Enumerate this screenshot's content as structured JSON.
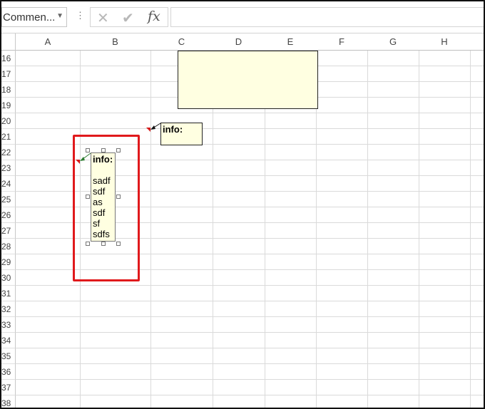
{
  "formula_bar": {
    "name_box_value": "Commen...",
    "dots": "⋮",
    "cancel_icon": "✕",
    "enter_icon": "✔",
    "fx_label": "fx",
    "formula_value": ""
  },
  "columns": [
    "A",
    "B",
    "C",
    "D",
    "E",
    "F",
    "G",
    "H"
  ],
  "rows": [
    "16",
    "17",
    "18",
    "19",
    "20",
    "21",
    "22",
    "23",
    "24",
    "25",
    "26",
    "27",
    "28",
    "29",
    "30",
    "31",
    "32",
    "33",
    "34",
    "35",
    "36",
    "37",
    "38"
  ],
  "comments": {
    "top_info": {
      "title": "info:"
    },
    "edit": {
      "title": "info:",
      "lines": [
        "",
        "sadf",
        "sdf",
        "as",
        "sdf",
        "sf",
        "sdfs"
      ]
    }
  },
  "colors": {
    "comment_fill": "#ffffe1",
    "highlight": "#e0191c",
    "indicator": "#d61b1b",
    "arrow_green": "#2e7d32"
  }
}
